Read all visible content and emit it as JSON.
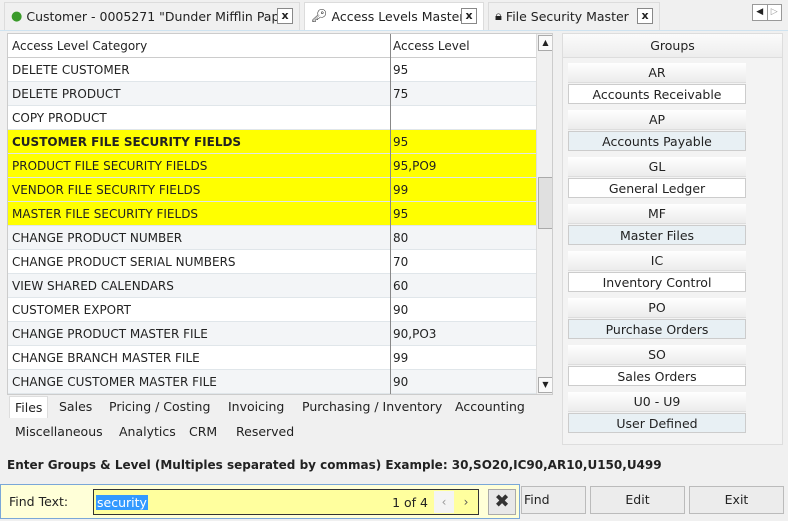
{
  "tabs": [
    {
      "label": "Customer - 0005271 \"Dunder Mifflin Pap",
      "icon": "user-icon",
      "close": "x"
    },
    {
      "label": "Access Levels Master",
      "icon": "key-icon",
      "close": "x"
    },
    {
      "label": "File Security Master",
      "icon": "lock-icon",
      "close": "x"
    }
  ],
  "grid": {
    "headers": [
      "Access Level Category",
      "Access Level"
    ],
    "rows": [
      {
        "category": "DELETE CUSTOMER",
        "level": "95"
      },
      {
        "category": "DELETE PRODUCT",
        "level": "75"
      },
      {
        "category": "COPY PRODUCT",
        "level": ""
      },
      {
        "category": "CUSTOMER FILE SECURITY FIELDS",
        "level": "95"
      },
      {
        "category": "PRODUCT FILE SECURITY FIELDS",
        "level": "95,PO9"
      },
      {
        "category": "VENDOR FILE SECURITY FIELDS",
        "level": "99"
      },
      {
        "category": "MASTER FILE SECURITY FIELDS",
        "level": "95"
      },
      {
        "category": "CHANGE PRODUCT NUMBER",
        "level": "80"
      },
      {
        "category": "CHANGE PRODUCT SERIAL NUMBERS",
        "level": "70"
      },
      {
        "category": "VIEW SHARED CALENDARS",
        "level": "60"
      },
      {
        "category": "CUSTOMER EXPORT",
        "level": "90"
      },
      {
        "category": "CHANGE PRODUCT MASTER FILE",
        "level": "90,PO3"
      },
      {
        "category": "CHANGE BRANCH MASTER FILE",
        "level": "99"
      },
      {
        "category": "CHANGE CUSTOMER MASTER FILE",
        "level": "90"
      }
    ],
    "highlight_color": "#ffff00"
  },
  "groups": {
    "title": "Groups",
    "items": [
      {
        "code": "AR",
        "name": "Accounts Receivable"
      },
      {
        "code": "AP",
        "name": "Accounts Payable"
      },
      {
        "code": "GL",
        "name": "General Ledger"
      },
      {
        "code": "MF",
        "name": "Master Files"
      },
      {
        "code": "IC",
        "name": "Inventory Control"
      },
      {
        "code": "PO",
        "name": "Purchase Orders"
      },
      {
        "code": "SO",
        "name": "Sales Orders"
      },
      {
        "code": "U0 - U9",
        "name": "User Defined"
      }
    ]
  },
  "category_tabs": [
    "Files",
    "Sales",
    "Pricing / Costing",
    "Invoicing",
    "Purchasing / Inventory",
    "Accounting",
    "Miscellaneous",
    "Analytics",
    "CRM",
    "Reserved"
  ],
  "instruction": "Enter Groups & Level (Multiples separated by commas)  Example: 30,SO20,IC90,AR10,U150,U499",
  "find": {
    "label": "Find Text:",
    "value": "security",
    "count": "1 of 4",
    "prev": "‹",
    "next": "›",
    "close": "✖"
  },
  "buttons": {
    "find": "Find",
    "edit": "Edit",
    "exit": "Exit"
  }
}
